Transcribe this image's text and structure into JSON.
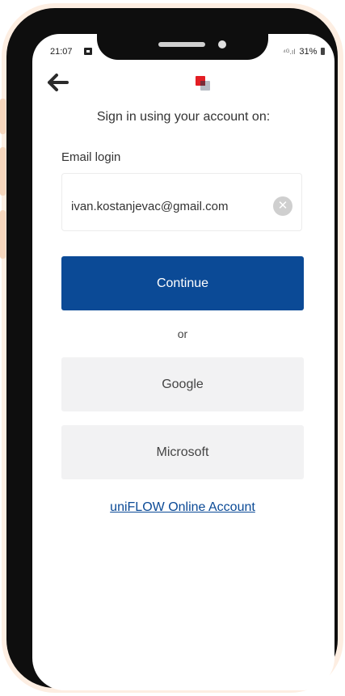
{
  "status_bar": {
    "time": "21:07",
    "signal": "⁴ᴳ.ıl",
    "battery": "31%"
  },
  "header": {
    "back_icon": "back-arrow-icon",
    "logo": "app-logo"
  },
  "main": {
    "subtitle": "Sign in using your account on:",
    "email_label": "Email login",
    "email_value": "ivan.kostanjevac@gmail.com",
    "clear_icon": "clear-icon",
    "continue_label": "Continue",
    "or_text": "or",
    "google_label": "Google",
    "microsoft_label": "Microsoft",
    "account_link": "uniFLOW Online Account"
  },
  "colors": {
    "primary": "#0b4a96",
    "logo_red": "#e31e24",
    "frame_halo": "#fdeee2"
  }
}
